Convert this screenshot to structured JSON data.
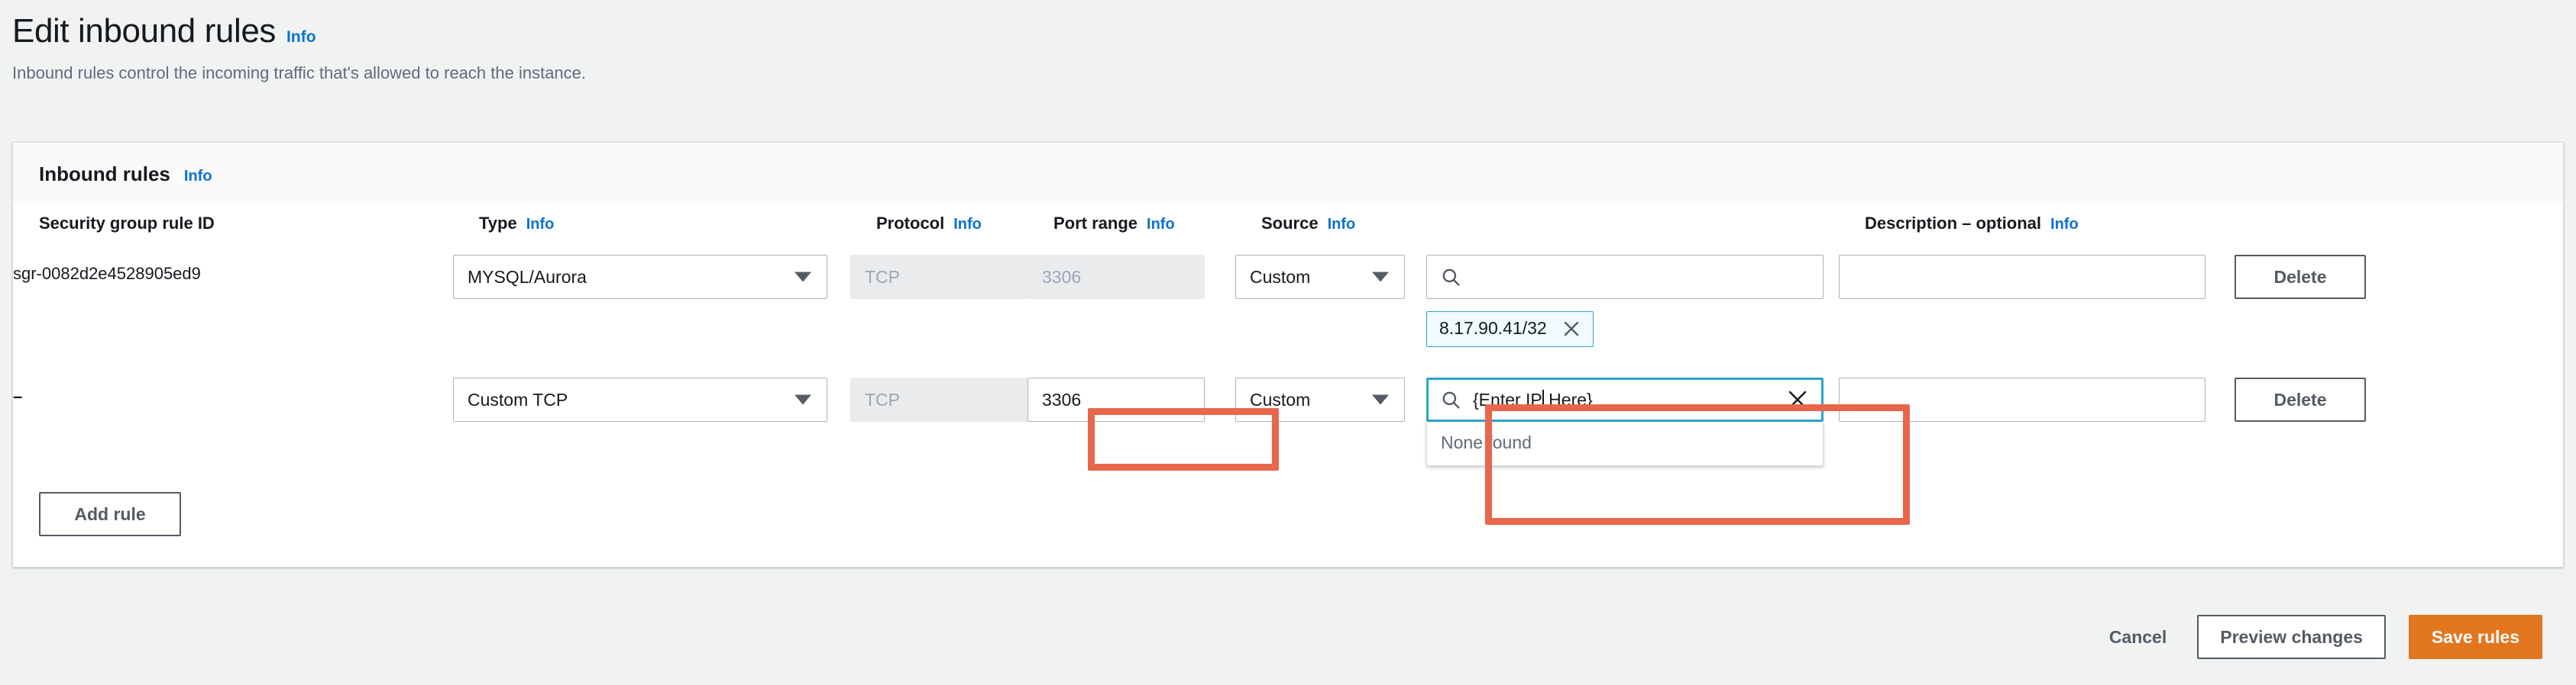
{
  "page": {
    "title": "Edit inbound rules",
    "info_label": "Info",
    "description": "Inbound rules control the incoming traffic that's allowed to reach the instance."
  },
  "panel": {
    "title": "Inbound rules",
    "info_label": "Info"
  },
  "columns": [
    {
      "label": "Security group rule ID",
      "info": ""
    },
    {
      "label": "Type",
      "info": "Info"
    },
    {
      "label": "Protocol",
      "info": "Info"
    },
    {
      "label": "Port range",
      "info": "Info"
    },
    {
      "label": "Source",
      "info": "Info"
    },
    {
      "label": "Description – optional",
      "info": "Info"
    }
  ],
  "rules": [
    {
      "rule_id": "sgr-0082d2e4528905ed9",
      "type": "MYSQL/Aurora",
      "protocol": "TCP",
      "protocol_disabled": true,
      "port_range": "3306",
      "port_disabled": true,
      "source_kind": "Custom",
      "source_search_value": "",
      "source_token": "8.17.90.41/32",
      "description": "",
      "delete_label": "Delete"
    },
    {
      "rule_id": "–",
      "type": "Custom TCP",
      "protocol": "TCP",
      "protocol_disabled": true,
      "port_range": "3306",
      "port_disabled": false,
      "source_kind": "Custom",
      "source_search_value": "{Enter IP Here}",
      "source_search_caret_after": "{Enter IP",
      "source_search_caret_rest": " Here}",
      "dropdown_empty_message": "None found",
      "description": "",
      "delete_label": "Delete"
    }
  ],
  "actions": {
    "add_rule_label": "Add rule",
    "cancel_label": "Cancel",
    "preview_label": "Preview changes",
    "save_label": "Save rules"
  },
  "colors": {
    "accent_link": "#0972d3",
    "primary_button": "#e2761f",
    "annotation": "#e8674c",
    "focus_border": "#2ea4c6",
    "page_bg": "#f1f3f3"
  }
}
